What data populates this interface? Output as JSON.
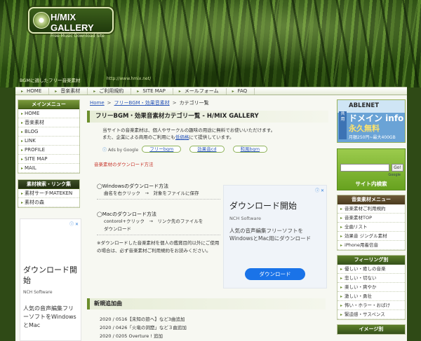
{
  "header": {
    "logo_title": "H/MIX GALLERY",
    "logo_sub": "Free Music Download Site",
    "tagline": "BGMに適したフリー音楽素材",
    "url": "http://www.hmix.net/"
  },
  "topnav": [
    "HOME",
    "音楽素材",
    "ご利用規約",
    "SITE MAP",
    "メールフォーム",
    "FAQ"
  ],
  "left": {
    "menu_title": "メインメニュー",
    "menu": [
      "HOME",
      "音楽素材",
      "BLOG",
      "LINK",
      "PROFILE",
      "SITE MAP",
      "MAIL"
    ],
    "links_title": "素材検索・リンク集",
    "links": [
      "素材サーチMATEKEN",
      "素材の森"
    ],
    "ad": {
      "title": "ダウンロード開始",
      "sub": "NCH Software",
      "body": "人気の音声編集フリーソフトをWindowsとMac"
    }
  },
  "main": {
    "breadcrumb": [
      "Home",
      "フリーBGM・効果音素材",
      "カテゴリ一覧"
    ],
    "title": "フリーBGM・効果音素材カテゴリ一覧 - H/MIX GALLERY",
    "intro1": "当サイトの音楽素材は、個人やサークルの趣味の用途に無料でお使いいただけます。",
    "intro2a": "また、企業による商用のご利用にも",
    "intro2b": "低価格",
    "intro2c": "にて提供しています。",
    "ads_by": "Ads by Google",
    "pills": [
      "フリーbgm",
      "効果音cd",
      "和風bgm"
    ],
    "download_link": "音楽素材のダウンロード方法",
    "howto": {
      "win_head": "◯Windowsのダウンロード方法",
      "win_line": "曲名を右クリック　→　対象をファイルに保存",
      "mac_head": "◯Macのダウンロード方法",
      "mac_line1": "contorol+クリック　→　リンク先のファイルを",
      "mac_line2": "ダウンロード",
      "note": "※ダウンロードした音楽素材を個人の鑑賞目的以外にご使用の場合は、必ず音楽素材ご利用規約をお読みください。"
    },
    "ad": {
      "title": "ダウンロード開始",
      "sub": "NCH Software",
      "body": "人気の音声編集フリーソフトをWindowsとMac用にダウンロード",
      "button": "ダウンロード"
    },
    "news_title": "新規追加曲",
    "news": [
      "2020 / 0516【未知の旅へ】など3曲追加",
      "2020 / 0426「火竜の洞窟」など３曲追加",
      "2020 / 0205 Overture ! 追加"
    ]
  },
  "right": {
    "ablenet": {
      "brand": "ABLENET",
      "side": "共用",
      "domain": "ドメイン info",
      "free": "永久無料",
      "price": "月額250円~最大400GB"
    },
    "search_go": "Go!",
    "search_label": "サイト内検索",
    "search_by": "Google",
    "music_title": "音楽素材メニュー",
    "music_menu": [
      "音楽素材ご利用規約",
      "音楽素材TOP",
      "全曲リスト",
      "効果音 ジングル素材",
      "iPhone用着信音"
    ],
    "feeling_title": "フィーリング別",
    "feeling_menu": [
      "優しい・癒しの音楽",
      "悲しい・切ない",
      "楽しい・爽やか",
      "激しい・勇壮",
      "怖い・ホラー・おばけ",
      "緊迫感・サスペンス"
    ],
    "image_title": "イメージ別"
  }
}
